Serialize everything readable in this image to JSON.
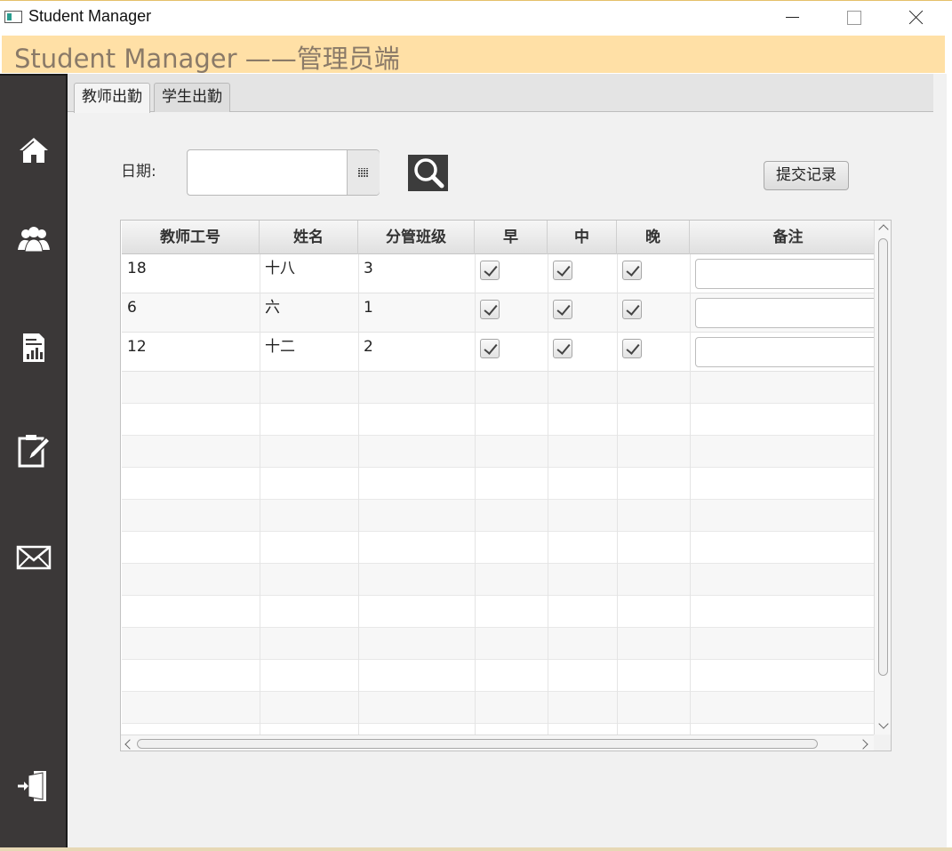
{
  "window": {
    "title": "Student Manager",
    "controls": [
      "minimize",
      "maximize",
      "close"
    ]
  },
  "banner": {
    "text": "Student Manager ——管理员端"
  },
  "sidebar": {
    "items": [
      {
        "icon": "home-icon"
      },
      {
        "icon": "users-icon"
      },
      {
        "icon": "report-icon"
      },
      {
        "icon": "edit-icon"
      },
      {
        "icon": "mail-icon"
      },
      {
        "icon": "logout-icon"
      }
    ]
  },
  "tabs": [
    {
      "label": "教师出勤",
      "active": true
    },
    {
      "label": "学生出勤",
      "active": false
    }
  ],
  "form": {
    "date_label": "日期:",
    "date_value": "",
    "submit_label": "提交记录"
  },
  "table": {
    "columns": [
      "教师工号",
      "姓名",
      "分管班级",
      "早",
      "中",
      "晚",
      "备注"
    ],
    "rows": [
      {
        "id": "18",
        "name": "十八",
        "class": "3",
        "morning": true,
        "noon": true,
        "evening": true,
        "remark": ""
      },
      {
        "id": "6",
        "name": "六",
        "class": "1",
        "morning": true,
        "noon": true,
        "evening": true,
        "remark": ""
      },
      {
        "id": "12",
        "name": "十二",
        "class": "2",
        "morning": true,
        "noon": true,
        "evening": true,
        "remark": ""
      }
    ]
  },
  "colors": {
    "banner_bg": "#ffe0a6",
    "banner_text": "#8a7a68",
    "sidebar_bg": "#3b3838",
    "content_bg": "#f1f1f1"
  }
}
